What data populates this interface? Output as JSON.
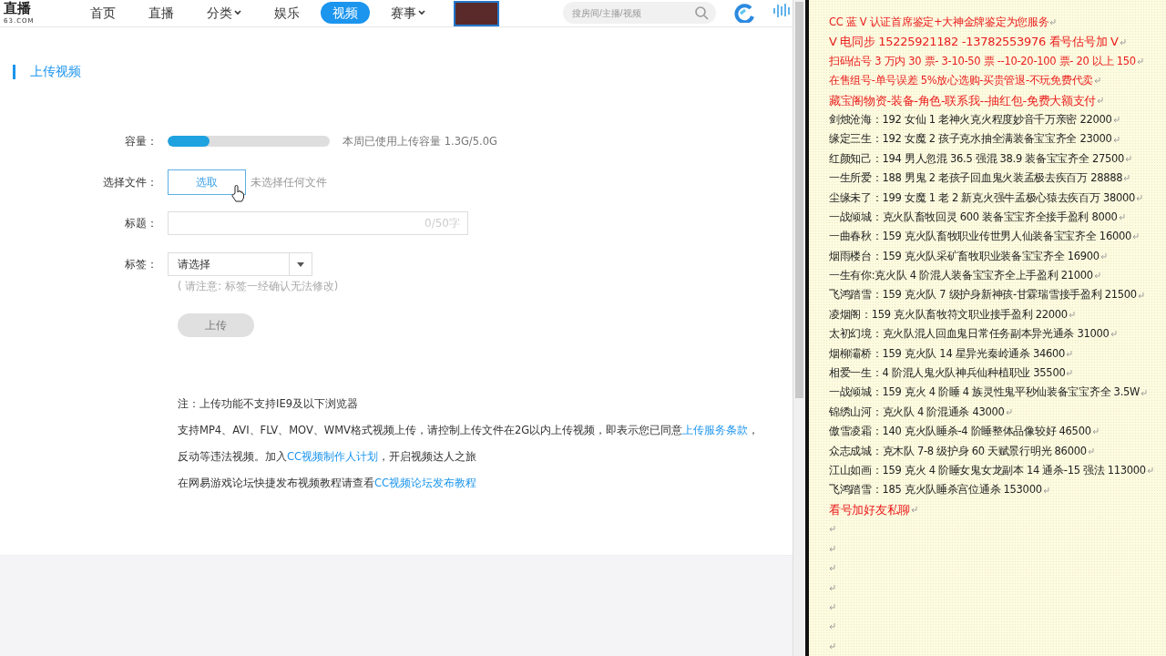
{
  "header": {
    "logo_text": "直播",
    "logo_sub": "63.COM",
    "nav": [
      {
        "label": "首页",
        "selected": false,
        "dropdown": false
      },
      {
        "label": "直播",
        "selected": false,
        "dropdown": false
      },
      {
        "label": "分类",
        "selected": false,
        "dropdown": true
      },
      {
        "label": "娱乐",
        "selected": false,
        "dropdown": false
      },
      {
        "label": "视频",
        "selected": true,
        "dropdown": false
      },
      {
        "label": "赛事",
        "selected": false,
        "dropdown": true
      }
    ],
    "search": {
      "placeholder": "搜房间/主播/视频"
    }
  },
  "section_title": "上传视频",
  "form": {
    "capacity": {
      "label": "容量：",
      "level": 0.26,
      "reading": "本周已使用上传容量 1.3G/5.0G"
    },
    "file": {
      "label": "选择文件：",
      "button": "选取",
      "status": "未选择任何文件"
    },
    "title": {
      "label": "标题：",
      "counter": "0/50字"
    },
    "tags": {
      "label": "标签：",
      "value": "请选择",
      "hint": "( 请注意: 标签一经确认无法修改)"
    },
    "submit": {
      "label": "上传",
      "disabled": true
    }
  },
  "notes": [
    [
      {
        "text": "注：上传功能不支持IE9及以下浏览器",
        "link": false
      }
    ],
    [
      {
        "text": "支持MP4、AVI、FLV、MOV、WMV格式视频上传，请控制上传文件在2G以内上传视频，即表示您已同意",
        "link": false
      },
      {
        "text": "上传服务条款",
        "link": true
      },
      {
        "text": "，",
        "link": false
      }
    ],
    [
      {
        "text": "反动等违法视频。加入",
        "link": false
      },
      {
        "text": "CC视频制作人计划",
        "link": true
      },
      {
        "text": "，开启视频达人之旅",
        "link": false
      }
    ],
    [
      {
        "text": "在网易游戏论坛快捷发布视频教程请查看",
        "link": false
      },
      {
        "text": "CC视频论坛发布教程",
        "link": true
      }
    ]
  ],
  "document": {
    "lines": [
      {
        "kind": "red",
        "text": "CC 蓝 V 认证首席鉴定+大神金牌鉴定为您服务"
      },
      {
        "kind": "red-large",
        "text": "V 电同步 15225921182 -13782553976 看号估号加 V"
      },
      {
        "kind": "red",
        "text": "扫码估号 3 万内 30 票- 3-10-50 票 --10-20-100 票- 20 以上 150"
      },
      {
        "kind": "red",
        "text": "在售组号-单号误差 5%放心选购-买贵管退-不玩免费代卖"
      },
      {
        "kind": "red-large",
        "text": "藏宝阁物资-装备-角色-联系我--抽红包-免费大额支付"
      },
      {
        "kind": "plain",
        "text": "剑烛沧海：192 女仙 1 老神火克火程度妙音千万亲密 22000"
      },
      {
        "kind": "plain",
        "text": "缘定三生：192 女魔 2 孩子克水抽全满装备宝宝齐全 23000"
      },
      {
        "kind": "plain",
        "text": "红颜知己：194 男人忽混 36.5 强混 38.9 装备宝宝齐全 27500"
      },
      {
        "kind": "plain",
        "text": "一生所爱：188 男鬼 2 老孩子回血鬼火装孟极去疾百万 28888"
      },
      {
        "kind": "plain",
        "text": "尘缘未了：199 女魔 1 老 2 新克火强牛孟极心猿去疾百万 38000"
      },
      {
        "kind": "plain",
        "text": "一战倾城：克火队畜牧回灵 600 装备宝宝齐全接手盈利 8000"
      },
      {
        "kind": "plain",
        "text": "一曲春秋：159 克火队畜牧职业传世男人仙装备宝宝齐全 16000"
      },
      {
        "kind": "plain",
        "text": "烟雨楼台：159 克火队采矿畜牧职业装备宝宝齐全 16900"
      },
      {
        "kind": "plain",
        "text": "一生有你:克火队 4 阶混人装备宝宝齐全上手盈利 21000"
      },
      {
        "kind": "plain",
        "text": "飞鸿踏雪：159 克火队 7 级护身新神孩-甘霖瑞雪接手盈利 21500"
      },
      {
        "kind": "plain",
        "text": "凌烟阁：159 克火队畜牧符文职业接手盈利 22000"
      },
      {
        "kind": "plain",
        "text": "太初幻境：克火队混人回血鬼日常任务副本异光通杀 31000"
      },
      {
        "kind": "plain",
        "text": "烟柳灞桥：159 克火队 14 星异光秦岭通杀 34600"
      },
      {
        "kind": "plain",
        "text": "相爱一生：4 阶混人鬼火队神兵仙种植职业 35500"
      },
      {
        "kind": "plain",
        "text": "一战倾城：159 克火 4 阶睡 4 族灵性鬼平秒仙装备宝宝齐全 3.5W"
      },
      {
        "kind": "plain",
        "text": "锦绣山河：克火队 4 阶混通杀 43000"
      },
      {
        "kind": "plain",
        "text": "傲雪凌霜：140 克火队睡杀-4 阶睡整体品像较好 46500"
      },
      {
        "kind": "plain",
        "text": "众志成城：克木队 7-8 级护身 60 天赋景行明光 86000"
      },
      {
        "kind": "plain",
        "text": "江山如画：159 克火 4 阶睡女鬼女龙副本 14 通杀-15 强法 113000"
      },
      {
        "kind": "plain",
        "text": "飞鸿踏雪：185 克火队睡杀宫位通杀 153000"
      },
      {
        "kind": "red-large",
        "text": "看号加好友私聊"
      },
      {
        "kind": "blank"
      },
      {
        "kind": "blank"
      },
      {
        "kind": "blank"
      },
      {
        "kind": "blank"
      },
      {
        "kind": "blank"
      },
      {
        "kind": "blank"
      },
      {
        "kind": "blank"
      }
    ]
  }
}
